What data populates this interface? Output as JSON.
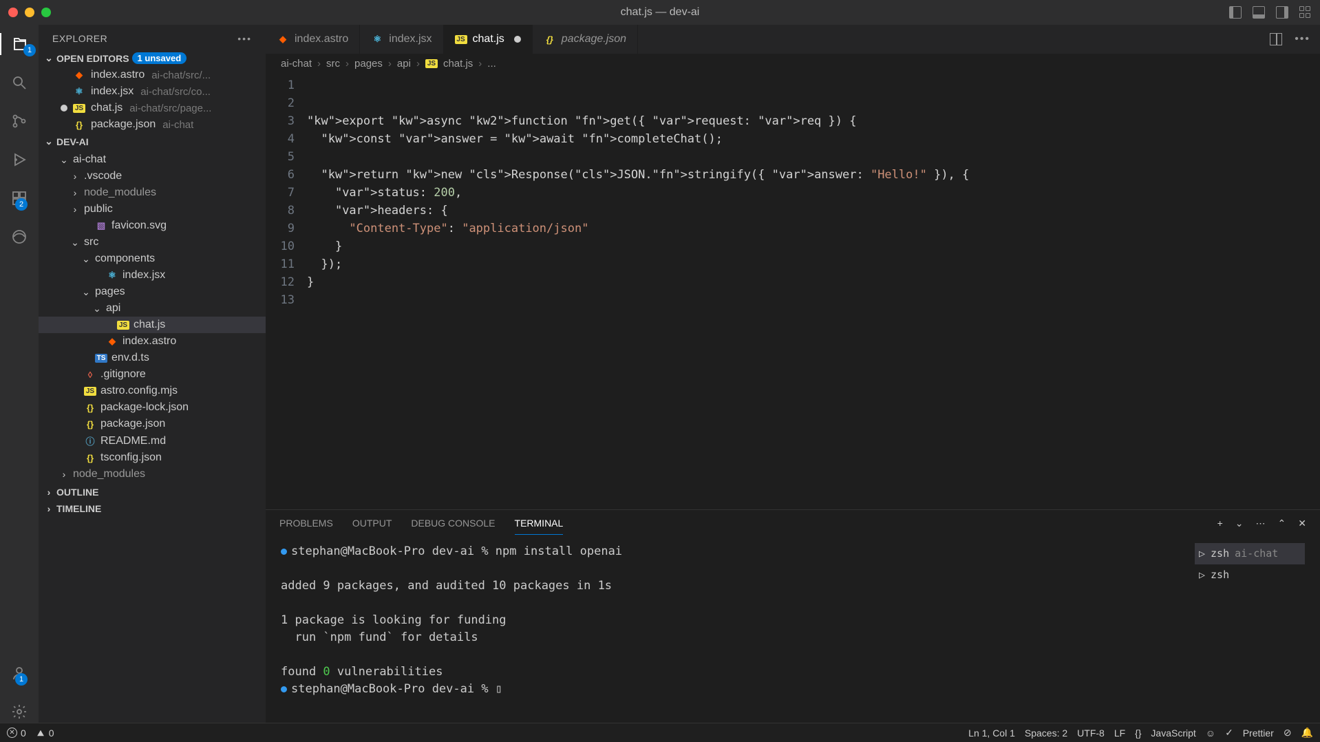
{
  "window": {
    "title": "chat.js — dev-ai"
  },
  "sidebar": {
    "title": "EXPLORER",
    "openEditorsLabel": "OPEN EDITORS",
    "unsavedBadge": "1 unsaved",
    "openEditors": [
      {
        "name": "index.astro",
        "path": "ai-chat/src/...",
        "iconClass": "fi-astro",
        "iconText": "◆"
      },
      {
        "name": "index.jsx",
        "path": "ai-chat/src/co...",
        "iconClass": "fi-react",
        "iconText": "⚛"
      },
      {
        "name": "chat.js",
        "path": "ai-chat/src/page...",
        "iconClass": "fi-js",
        "iconText": "JS",
        "modified": true
      },
      {
        "name": "package.json",
        "path": "ai-chat",
        "iconClass": "fi-json",
        "iconText": "{}"
      }
    ],
    "projectLabel": "DEV-AI",
    "outlineLabel": "OUTLINE",
    "timelineLabel": "TIMELINE",
    "tree": {
      "root": "ai-chat",
      "items": [
        {
          "indent": 1,
          "type": "folder",
          "open": true,
          "name": "ai-chat"
        },
        {
          "indent": 2,
          "type": "folder",
          "open": false,
          "name": ".vscode"
        },
        {
          "indent": 2,
          "type": "folder",
          "open": false,
          "name": "node_modules",
          "dim": true
        },
        {
          "indent": 2,
          "type": "folder",
          "open": false,
          "name": "public"
        },
        {
          "indent": 3,
          "type": "file",
          "name": "favicon.svg",
          "iconClass": "fi-svg",
          "iconText": "▧"
        },
        {
          "indent": 2,
          "type": "folder",
          "open": true,
          "name": "src"
        },
        {
          "indent": 3,
          "type": "folder",
          "open": true,
          "name": "components"
        },
        {
          "indent": 4,
          "type": "file",
          "name": "index.jsx",
          "iconClass": "fi-react",
          "iconText": "⚛"
        },
        {
          "indent": 3,
          "type": "folder",
          "open": true,
          "name": "pages"
        },
        {
          "indent": 4,
          "type": "folder",
          "open": true,
          "name": "api"
        },
        {
          "indent": 5,
          "type": "file",
          "name": "chat.js",
          "iconClass": "fi-js",
          "iconText": "JS",
          "selected": true
        },
        {
          "indent": 4,
          "type": "file",
          "name": "index.astro",
          "iconClass": "fi-astro",
          "iconText": "◆"
        },
        {
          "indent": 3,
          "type": "file",
          "name": "env.d.ts",
          "iconClass": "fi-ts",
          "iconText": "TS"
        },
        {
          "indent": 2,
          "type": "file",
          "name": ".gitignore",
          "iconClass": "fi-git",
          "iconText": "◊"
        },
        {
          "indent": 2,
          "type": "file",
          "name": "astro.config.mjs",
          "iconClass": "fi-js",
          "iconText": "JS"
        },
        {
          "indent": 2,
          "type": "file",
          "name": "package-lock.json",
          "iconClass": "fi-json",
          "iconText": "{}"
        },
        {
          "indent": 2,
          "type": "file",
          "name": "package.json",
          "iconClass": "fi-json",
          "iconText": "{}"
        },
        {
          "indent": 2,
          "type": "file",
          "name": "README.md",
          "iconClass": "fi-md",
          "iconText": "ⓘ"
        },
        {
          "indent": 2,
          "type": "file",
          "name": "tsconfig.json",
          "iconClass": "fi-json",
          "iconText": "{}"
        },
        {
          "indent": 1,
          "type": "folder",
          "open": false,
          "name": "node_modules",
          "dim": true
        }
      ]
    }
  },
  "tabs": [
    {
      "name": "index.astro",
      "iconClass": "fi-astro",
      "iconText": "◆"
    },
    {
      "name": "index.jsx",
      "iconClass": "fi-react",
      "iconText": "⚛"
    },
    {
      "name": "chat.js",
      "iconClass": "fi-js",
      "iconText": "JS",
      "active": true,
      "modified": true
    },
    {
      "name": "package.json",
      "iconClass": "fi-json",
      "iconText": "{}",
      "italic": true
    }
  ],
  "breadcrumbs": [
    "ai-chat",
    "src",
    "pages",
    "api",
    "chat.js",
    "..."
  ],
  "breadcrumbFileIcon": {
    "class": "fi-js",
    "text": "JS"
  },
  "code": {
    "lines": [
      "",
      "",
      "export async function get({ request: req }) {",
      "  const answer = await completeChat();",
      "",
      "  return new Response(JSON.stringify({ answer: \"Hello!\" }), {",
      "    status: 200,",
      "    headers: {",
      "      \"Content-Type\": \"application/json\"",
      "    }",
      "  });",
      "}",
      ""
    ]
  },
  "panel": {
    "tabs": [
      "PROBLEMS",
      "OUTPUT",
      "DEBUG CONSOLE",
      "TERMINAL"
    ],
    "activeTab": "TERMINAL",
    "terminal": {
      "prompt1": "stephan@MacBook-Pro dev-ai % ",
      "cmd1": "npm install openai",
      "out1": "added 9 packages, and audited 10 packages in 1s",
      "out2": "1 package is looking for funding",
      "out3": "  run `npm fund` for details",
      "out4a": "found ",
      "out4b": "0",
      "out4c": " vulnerabilities",
      "prompt2": "stephan@MacBook-Pro dev-ai % ",
      "cursor": "▯"
    },
    "sessions": [
      {
        "name": "zsh",
        "label": "ai-chat",
        "active": true
      },
      {
        "name": "zsh",
        "label": ""
      }
    ]
  },
  "statusbar": {
    "errors": "0",
    "warnings": "0",
    "position": "Ln 1, Col 1",
    "spaces": "Spaces: 2",
    "encoding": "UTF-8",
    "eol": "LF",
    "langIcon": "{}",
    "language": "JavaScript",
    "prettier": "Prettier"
  },
  "activity": {
    "explorerBadge": "1",
    "extensionsBadge": "2",
    "accountBadge": "1"
  }
}
